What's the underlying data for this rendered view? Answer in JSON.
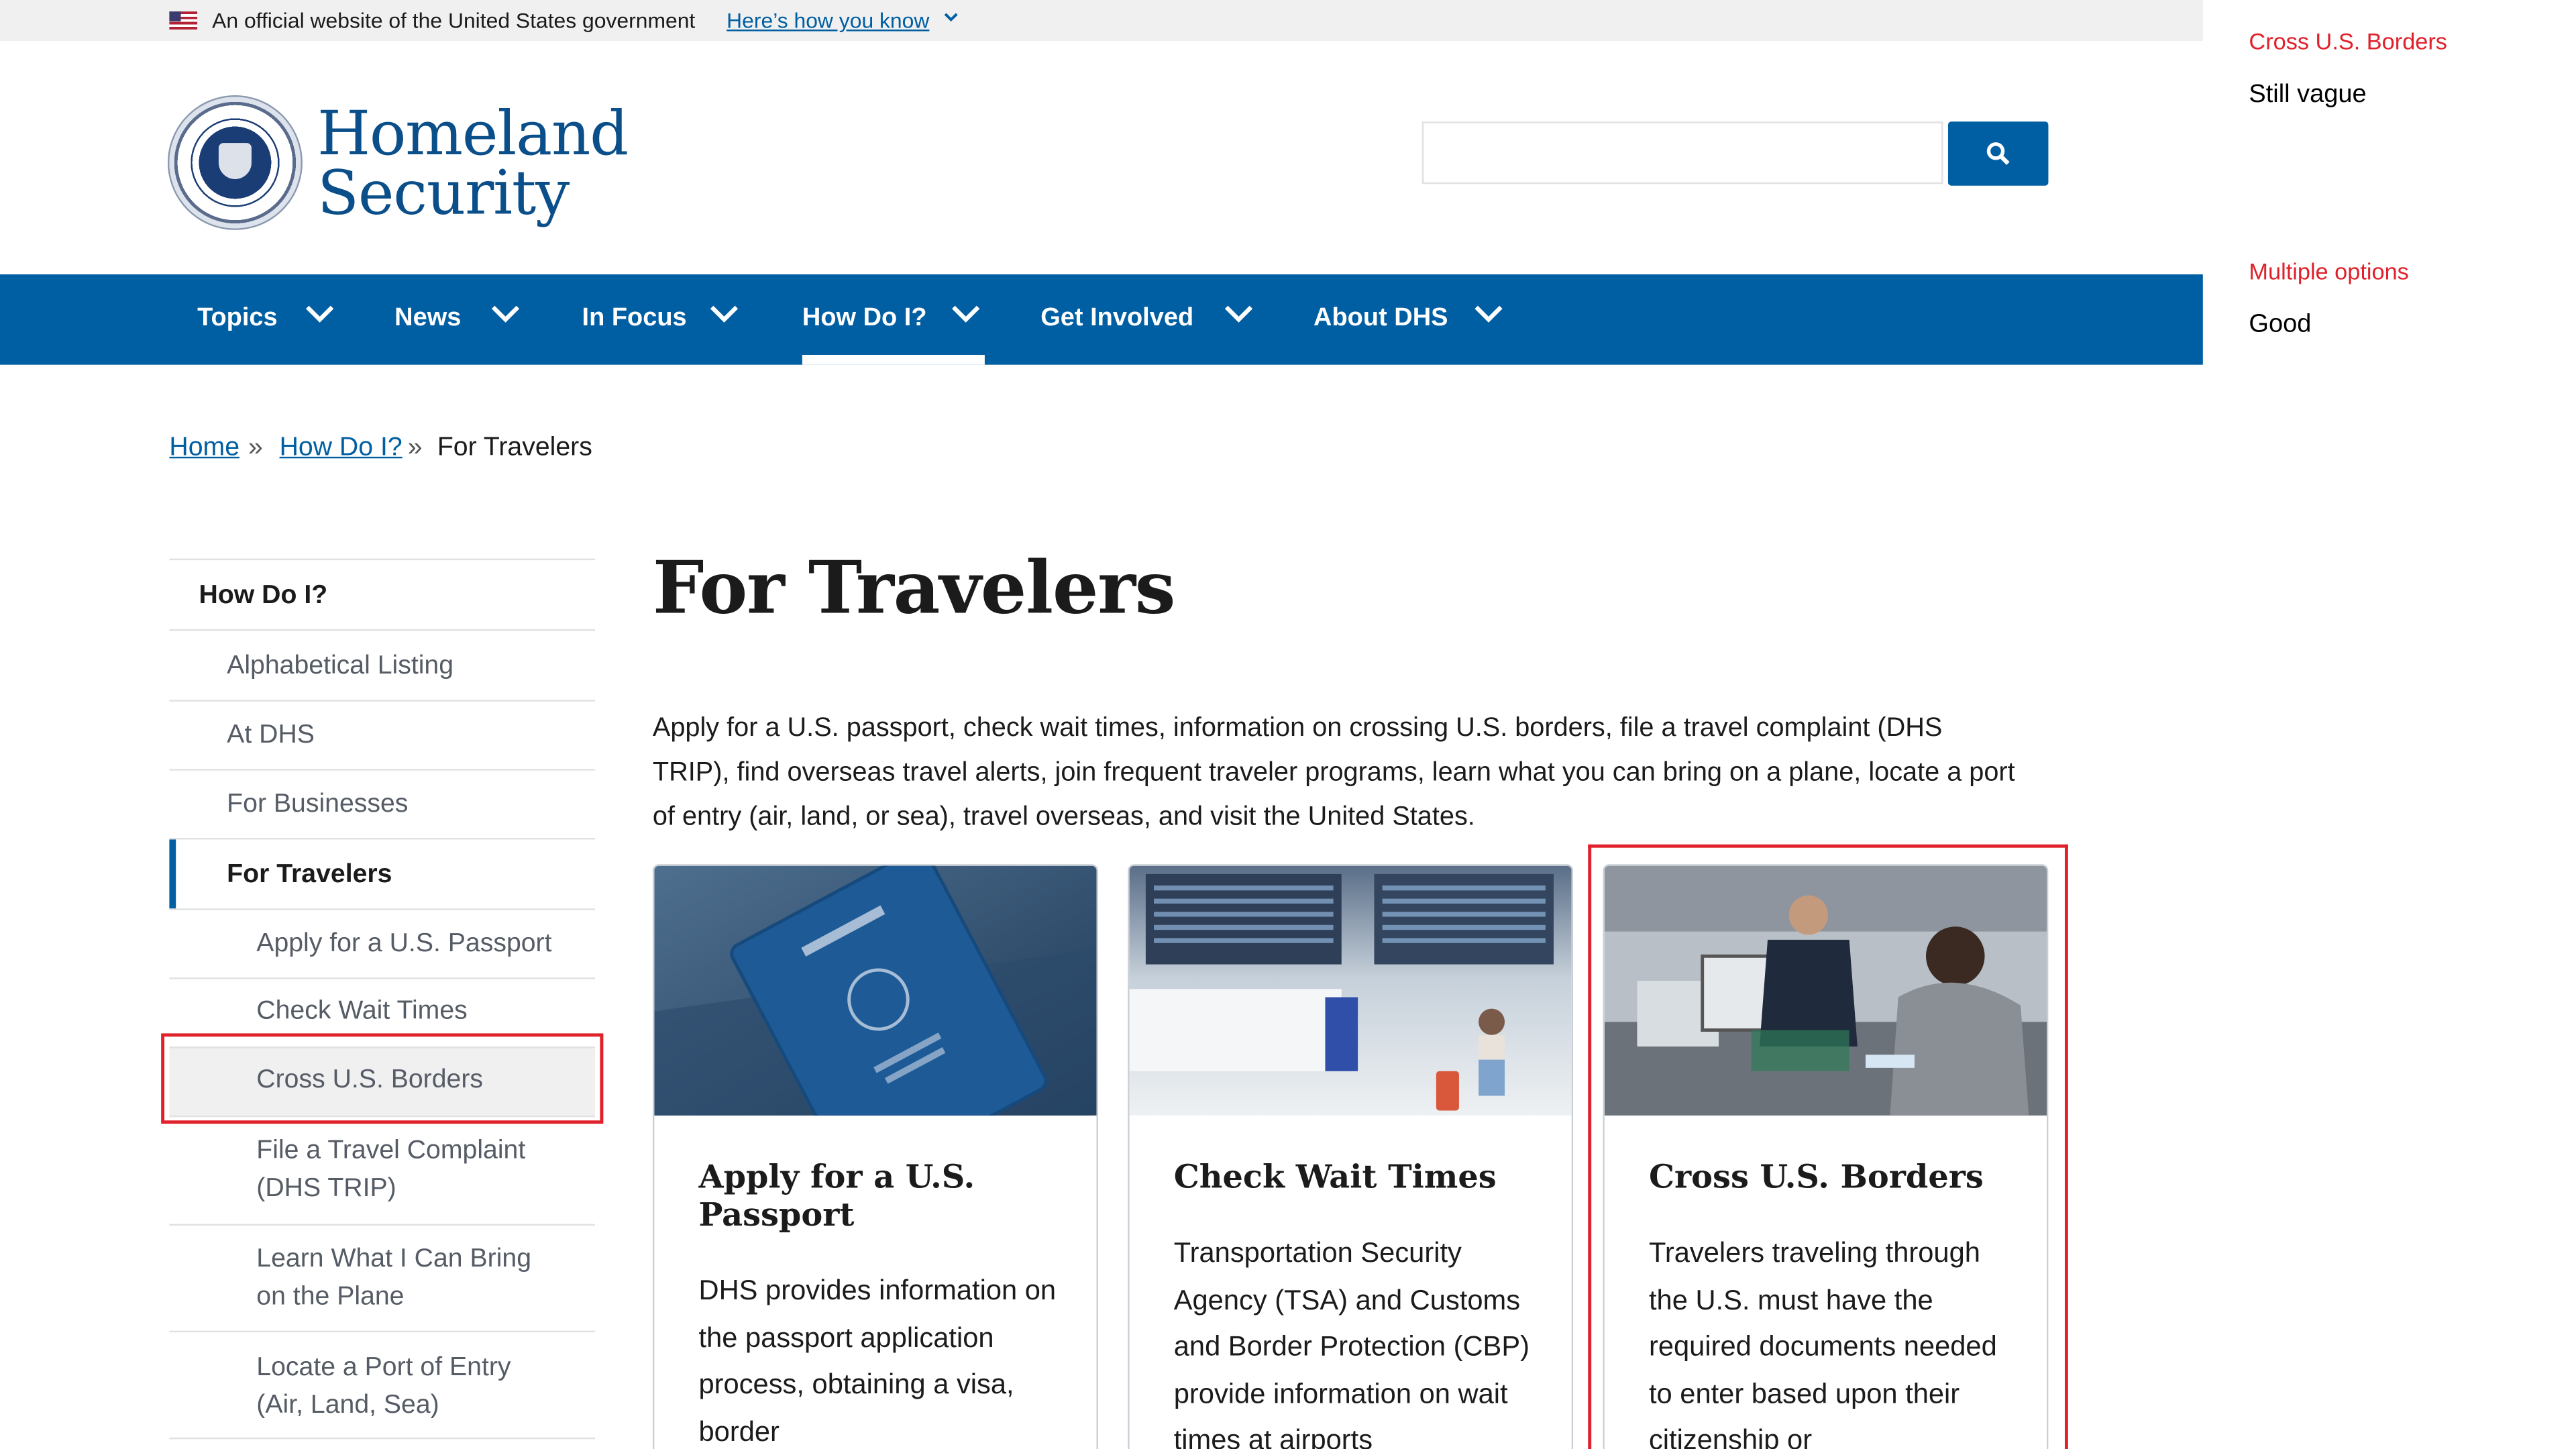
{
  "gov_banner": {
    "text": "An official website of the United States government",
    "link": "Here’s how you know"
  },
  "logo": {
    "line1": "Homeland",
    "line2": "Security"
  },
  "search": {
    "placeholder": "",
    "button_icon": "search-icon"
  },
  "nav": {
    "items": [
      "Topics",
      "News",
      "In Focus",
      "How Do I?",
      "Get Involved",
      "About DHS"
    ],
    "active": "How Do I?"
  },
  "breadcrumb": {
    "items": [
      "Home",
      "How Do I?",
      "For Travelers"
    ],
    "separator": "»"
  },
  "side_nav": {
    "heading": "How Do I?",
    "items": [
      "Alphabetical Listing",
      "At DHS",
      "For Businesses",
      "For Travelers"
    ],
    "sub_items": [
      "Apply for a U.S. Passport",
      "Check Wait Times",
      "Cross U.S. Borders",
      "File a Travel Complaint (DHS TRIP)",
      "Learn What I Can Bring on the Plane",
      "Locate a Port of Entry (Air, Land, Sea)"
    ],
    "highlighted": "Cross U.S. Borders"
  },
  "main": {
    "title": "For Travelers",
    "intro": "Apply for a U.S. passport, check wait times, information on crossing U.S. borders, file a travel complaint (DHS TRIP), find overseas travel alerts, join frequent traveler programs, learn what you can bring on a plane, locate a port of entry (air, land, or sea), travel overseas, and visit the United States.",
    "cards": [
      {
        "title": "Apply for a U.S. Passport",
        "body": "DHS provides information on the passport application process, obtaining a visa, border",
        "image": "passport-photo"
      },
      {
        "title": "Check Wait Times",
        "body": "Transportation Security Agency (TSA) and Customs and Border Protection (CBP) provide information on wait times at airports",
        "image": "airport-photo"
      },
      {
        "title": "Cross U.S. Borders",
        "body": "Travelers traveling through the U.S. must have the required documents needed to enter based upon their citizenship or",
        "image": "border-officer-photo"
      }
    ]
  },
  "annotations": [
    {
      "heading": "Cross U.S. Borders",
      "value": "Still vague"
    },
    {
      "heading": "Multiple options",
      "value": "Good"
    }
  ],
  "colors": {
    "primary": "#005ea2",
    "highlight": "#e0202a",
    "logo": "#0a4e8a"
  }
}
